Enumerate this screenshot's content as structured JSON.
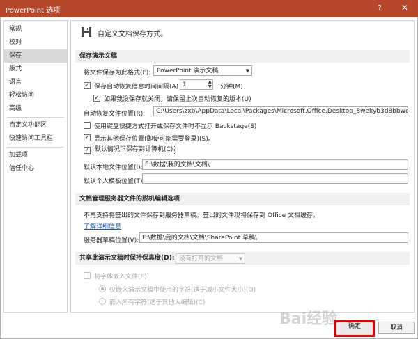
{
  "window": {
    "title": "PowerPoint 选项",
    "help": "?",
    "close": "✕"
  },
  "sidebar": {
    "items": [
      "常规",
      "校对",
      "保存",
      "版式",
      "语言",
      "轻松访问",
      "高级",
      "自定义功能区",
      "快速访问工具栏",
      "加载项",
      "信任中心"
    ],
    "selected": 2
  },
  "header": {
    "title": "自定义文档保存方式。"
  },
  "save_section": {
    "title": "保存演示文稿",
    "format_label": "将文件保存为此格式(F):",
    "format_value": "PowerPoint 演示文稿",
    "autosave_label": "保存自动恢复信息时间间隔(A)",
    "autosave_minutes": "1",
    "minutes_unit": "分钟(M)",
    "keep_last_label": "如果我没保存就关闭，请保留上次自动恢复的版本(U)",
    "autorecover_label": "自动恢复文件位置(R):",
    "autorecover_path": "C:\\Users\\zxb\\AppData\\Local\\Packages\\Microsoft.Office.Desktop_8wekyb3d8bbwe\\Local",
    "backstage_label": "使用键盘快捷方式打开或保存文件时不显示 Backstage(S)",
    "show_locations_label": "显示其他保存位置(即使可能需要登录)(S)。",
    "default_computer_label": "默认情况下保存到计算机(C)",
    "local_location_label": "默认本地文件位置(I):",
    "local_location_value": "E:\\数据\\我的文档\\文档\\",
    "template_location_label": "默认个人模板位置(T):",
    "template_location_value": ""
  },
  "offline_section": {
    "title": "文档管理服务器文件的脱机编辑选项",
    "description": "不再支持将签出的文件保存到服务器草稿。签出的文件现将保存到 Office 文档缓存。",
    "learn_more": "了解详细信息",
    "drafts_label": "服务器草稿位置(V):",
    "drafts_value": "E:\\数据\\我的文档\\文档\\SharePoint 草稿\\"
  },
  "fidelity_section": {
    "title": "共享此演示文稿时保持保真度(D):",
    "document_value": "没有打开的文档",
    "embed_fonts_label": "将字体嵌入文件(E)",
    "embed_used_label": "仅嵌入演示文稿中使用的字符(适于减小文件大小)(O)",
    "embed_all_label": "嵌入所有字符(适于其他人编辑)(C)"
  },
  "footer": {
    "ok": "确定",
    "cancel": "取消"
  },
  "watermark": "Bai经验",
  "colors": {
    "titlebar": "#b7472a",
    "highlight": "#e10000",
    "link": "#1e5aa8"
  }
}
